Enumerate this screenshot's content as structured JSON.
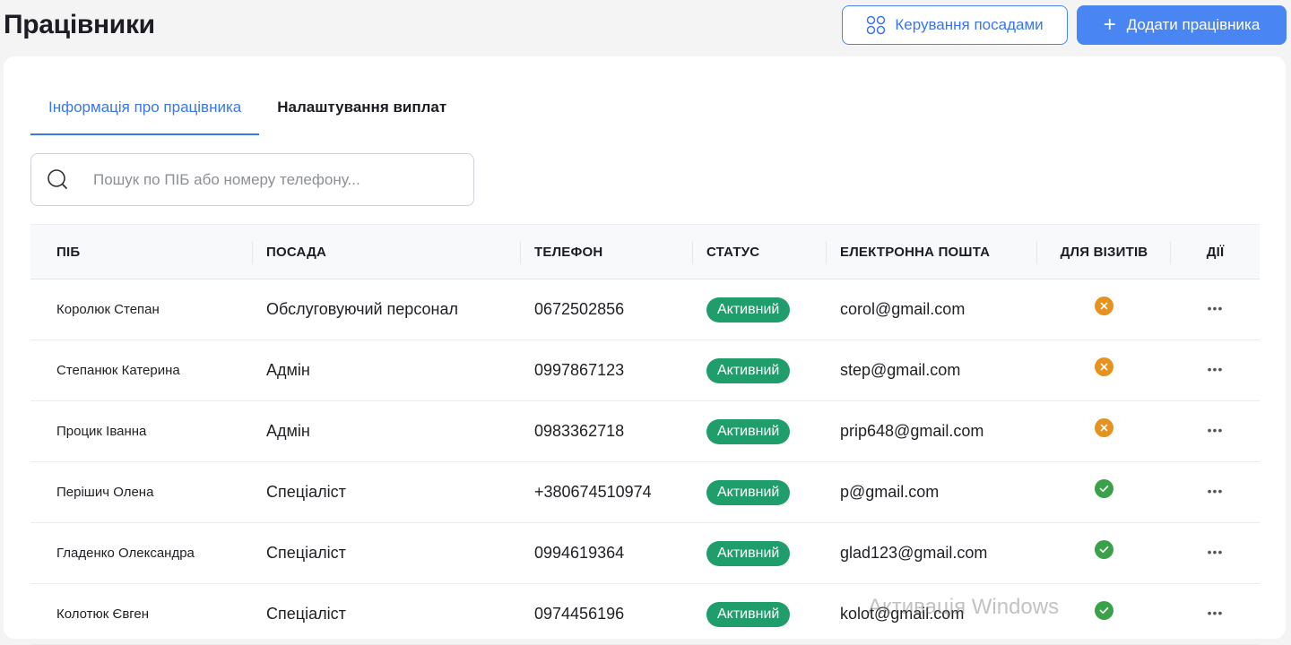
{
  "header": {
    "title": "Працівники",
    "manage_positions_label": "Керування посадами",
    "add_employee_label": "Додати працівника"
  },
  "tabs": [
    {
      "label": "Інформація про працівника",
      "active": true
    },
    {
      "label": "Налаштування виплат",
      "active": false
    }
  ],
  "search": {
    "placeholder": "Пошук по ПІБ або номеру телефону...",
    "value": ""
  },
  "table": {
    "columns": [
      "ПІБ",
      "ПОСАДА",
      "ТЕЛЕФОН",
      "СТАТУС",
      "ЕЛЕКТРОННА ПОШТА",
      "ДЛЯ ВІЗИТІВ",
      "ДІЇ"
    ],
    "rows": [
      {
        "name": "Королюк Степан",
        "position": "Обслуговуючий персонал",
        "phone": "0672502856",
        "status": "Активний",
        "email": "corol@gmail.com",
        "for_visits": false
      },
      {
        "name": "Степанюк Катерина",
        "position": "Адмін",
        "phone": "0997867123",
        "status": "Активний",
        "email": "step@gmail.com",
        "for_visits": false
      },
      {
        "name": "Процик Іванна",
        "position": "Адмін",
        "phone": "0983362718",
        "status": "Активний",
        "email": "prip648@gmail.com",
        "for_visits": false
      },
      {
        "name": "Перішич Олена",
        "position": "Спеціаліст",
        "phone": "+380674510974",
        "status": "Активний",
        "email": "p@gmail.com",
        "for_visits": true
      },
      {
        "name": "Гладенко Олександра",
        "position": "Спеціаліст",
        "phone": "0994619364",
        "status": "Активний",
        "email": "glad123@gmail.com",
        "for_visits": true
      },
      {
        "name": "Колотюк Євген",
        "position": "Спеціаліст",
        "phone": "0974456196",
        "status": "Активний",
        "email": "kolot@gmail.com",
        "for_visits": true
      }
    ],
    "actions_glyph": "•••"
  },
  "icons": {
    "manage_positions": "grid-circles-icon",
    "add": "plus-icon",
    "search": "search-icon",
    "visit_no": "x-circle-icon",
    "visit_yes": "check-circle-icon",
    "actions": "more-dots-icon"
  },
  "colors": {
    "accent": "#3b76ea",
    "primary_button": "#4a86f3",
    "status_active": "#1f9d6a",
    "visit_no": "#e7911f",
    "visit_yes": "#3aa14a"
  },
  "watermark": "Активація Windows"
}
